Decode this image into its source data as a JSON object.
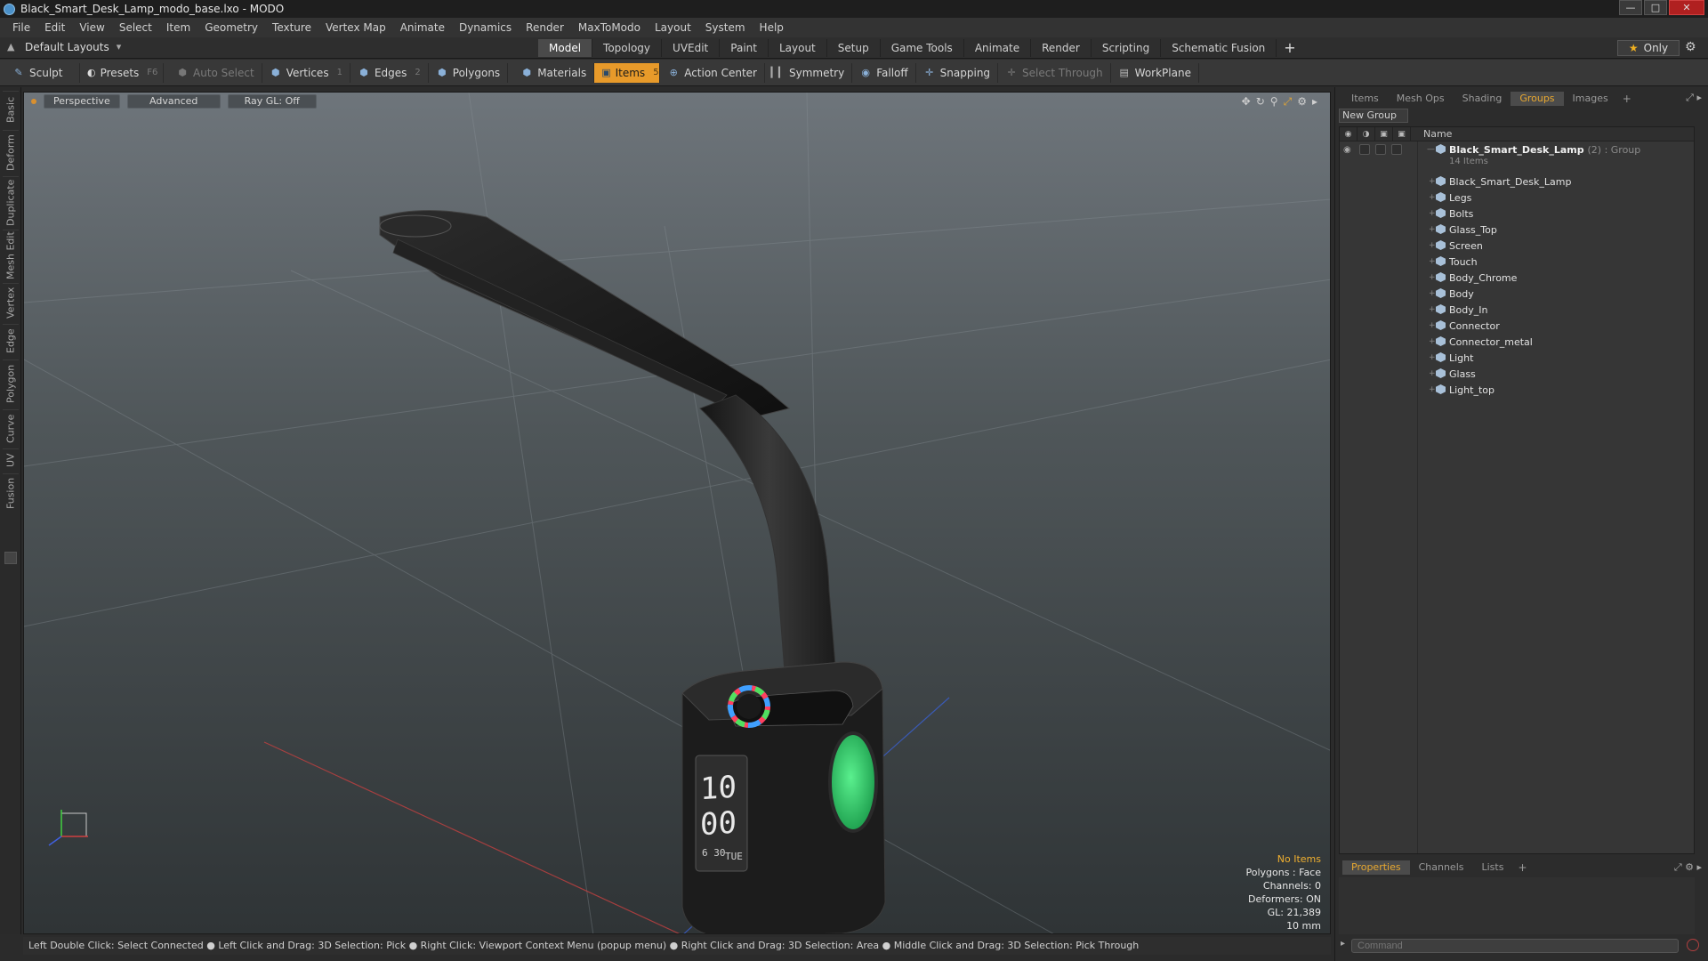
{
  "window": {
    "title": "Black_Smart_Desk_Lamp_modo_base.lxo - MODO",
    "buttons": [
      "minimize",
      "maximize",
      "close"
    ]
  },
  "menu": [
    "File",
    "Edit",
    "View",
    "Select",
    "Item",
    "Geometry",
    "Texture",
    "Vertex Map",
    "Animate",
    "Dynamics",
    "Render",
    "MaxToModo",
    "Layout",
    "System",
    "Help"
  ],
  "layoutbar": {
    "layout_label": "Default Layouts",
    "tabs": [
      "Model",
      "Topology",
      "UVEdit",
      "Paint",
      "Layout",
      "Setup",
      "Game Tools",
      "Animate",
      "Render",
      "Scripting",
      "Schematic Fusion"
    ],
    "active_tab": "Model",
    "add_tab": "+",
    "only_label": "Only"
  },
  "toolbar": {
    "sculpt": "Sculpt",
    "presets": "Presets",
    "presets_key": "F6",
    "auto_select": "Auto Select",
    "vertices": "Vertices",
    "vertices_key": "1",
    "edges": "Edges",
    "edges_key": "2",
    "polygons": "Polygons",
    "materials": "Materials",
    "items": "Items",
    "items_key": "5",
    "action_center": "Action Center",
    "symmetry": "Symmetry",
    "falloff": "Falloff",
    "snapping": "Snapping",
    "select_through": "Select Through",
    "workplane": "WorkPlane"
  },
  "lefttabs": [
    "Basic",
    "Deform",
    "Duplicate",
    "Mesh Edit",
    "Vertex",
    "Edge",
    "Polygon",
    "Curve",
    "UV",
    "Fusion"
  ],
  "viewport": {
    "view_label": "Perspective",
    "shading_label": "Advanced",
    "raygl_label": "Ray GL: Off",
    "stats": {
      "selection": "No Items",
      "polygons": "Polygons : Face",
      "channels": "Channels: 0",
      "deformers": "Deformers: ON",
      "gl": "GL: 21,389",
      "unit": "10 mm"
    },
    "lamp_display": {
      "hour": "10",
      "minute": "00",
      "date": "6 30",
      "day": "TUE"
    }
  },
  "statusbar": "Left Double Click: Select Connected ● Left Click and Drag: 3D Selection: Pick ● Right Click: Viewport Context Menu (popup menu) ● Right Click and Drag: 3D Selection: Area ● Middle Click and Drag: 3D Selection: Pick Through",
  "rightpanel": {
    "tabs": [
      "Items",
      "Mesh Ops",
      "Shading",
      "Groups",
      "Images"
    ],
    "active_tab": "Groups",
    "add_tab": "+",
    "new_group": "New Group",
    "column_name": "Name",
    "group": {
      "name": "Black_Smart_Desk_Lamp",
      "suffix": "(2) : Group",
      "count": "14 Items"
    },
    "items": [
      "Black_Smart_Desk_Lamp",
      "Legs",
      "Bolts",
      "Glass_Top",
      "Screen",
      "Touch",
      "Body_Chrome",
      "Body",
      "Body_In",
      "Connector",
      "Connector_metal",
      "Light",
      "Glass",
      "Light_top"
    ],
    "bottom_tabs": [
      "Properties",
      "Channels",
      "Lists"
    ],
    "bottom_active": "Properties",
    "command_placeholder": "Command"
  },
  "colors": {
    "accent": "#e89a2a",
    "active_tab_text": "#e8a830",
    "lamp_body": "#1c1c1c",
    "lamp_green": "#2ed36a"
  }
}
